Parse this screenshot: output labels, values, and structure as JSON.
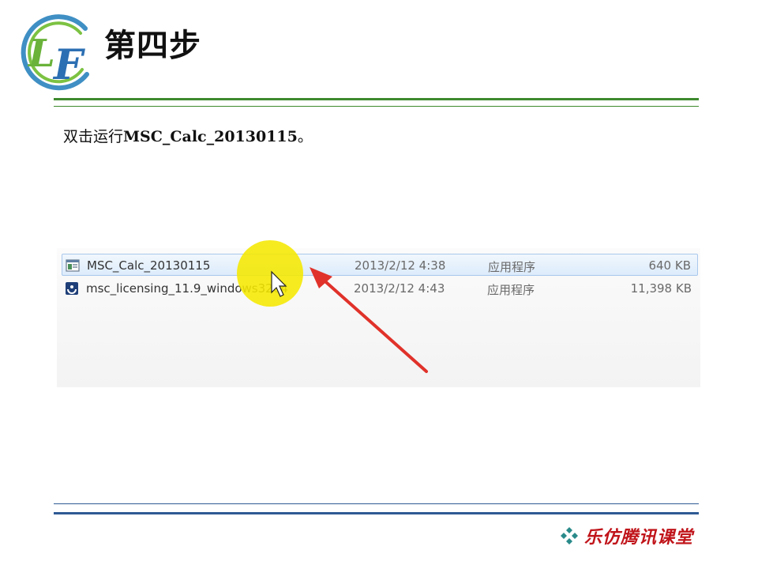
{
  "slide": {
    "logo_text": "LF",
    "title": "第四步",
    "instruction_prefix": "双击运行",
    "instruction_command": "MSC_Calc_20130115",
    "instruction_suffix": "。"
  },
  "files": [
    {
      "name": "MSC_Calc_20130115",
      "date": "2013/2/12 4:38",
      "type": "应用程序",
      "size": "640 KB",
      "icon": "exe-window-icon",
      "selected": true
    },
    {
      "name": "msc_licensing_11.9_windows3264",
      "date": "2013/2/12 4:43",
      "type": "应用程序",
      "size": "11,398 KB",
      "icon": "installer-icon",
      "selected": false
    }
  ],
  "footer": {
    "brand": "乐仿腾讯课堂",
    "bullet_icon": "diamond-cluster-icon"
  },
  "colors": {
    "green_rule": "#3e8a2e",
    "blue_rule": "#2f5a95",
    "highlight": "#f5e800",
    "arrow": "#e0322a",
    "brand_red": "#c0141a"
  }
}
